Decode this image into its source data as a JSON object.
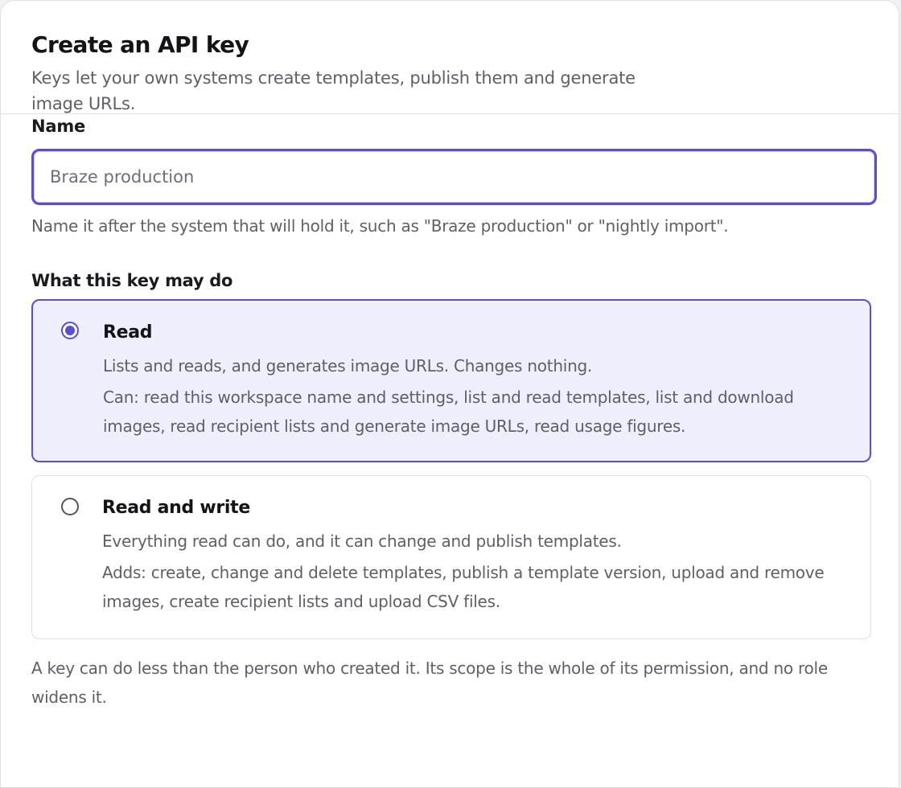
{
  "dialog": {
    "title": "Create an API key",
    "subtitle": "Keys let your own systems create templates, publish them and generate image URLs."
  },
  "name_field": {
    "label": "Name",
    "placeholder": "Braze production",
    "value": "",
    "hint": "Name it after the system that will hold it, such as \"Braze production\" or \"nightly import\"."
  },
  "permissions": {
    "label": "What this key may do",
    "options": [
      {
        "title": "Read",
        "description": "Lists and reads, and generates image URLs. Changes nothing.",
        "detail": "Can: read this workspace name and settings, list and read templates, list and download images, read recipient lists and generate image URLs, read usage figures.",
        "selected": true
      },
      {
        "title": "Read and write",
        "description": "Everything read can do, and it can change and publish templates.",
        "detail": "Adds: create, change and delete templates, publish a template version, upload and remove images, create recipient lists and upload CSV files.",
        "selected": false
      }
    ],
    "footnote": "A key can do less than the person who created it. Its scope is the whole of its permission, and no role widens it."
  },
  "colors": {
    "accent": "#5a4fd1",
    "selected_background": "#eeeefc",
    "muted_text": "#5f5f68"
  },
  "icons": {
    "selected_radio": "radio-checked-icon",
    "unselected_radio": "radio-unchecked-icon"
  }
}
